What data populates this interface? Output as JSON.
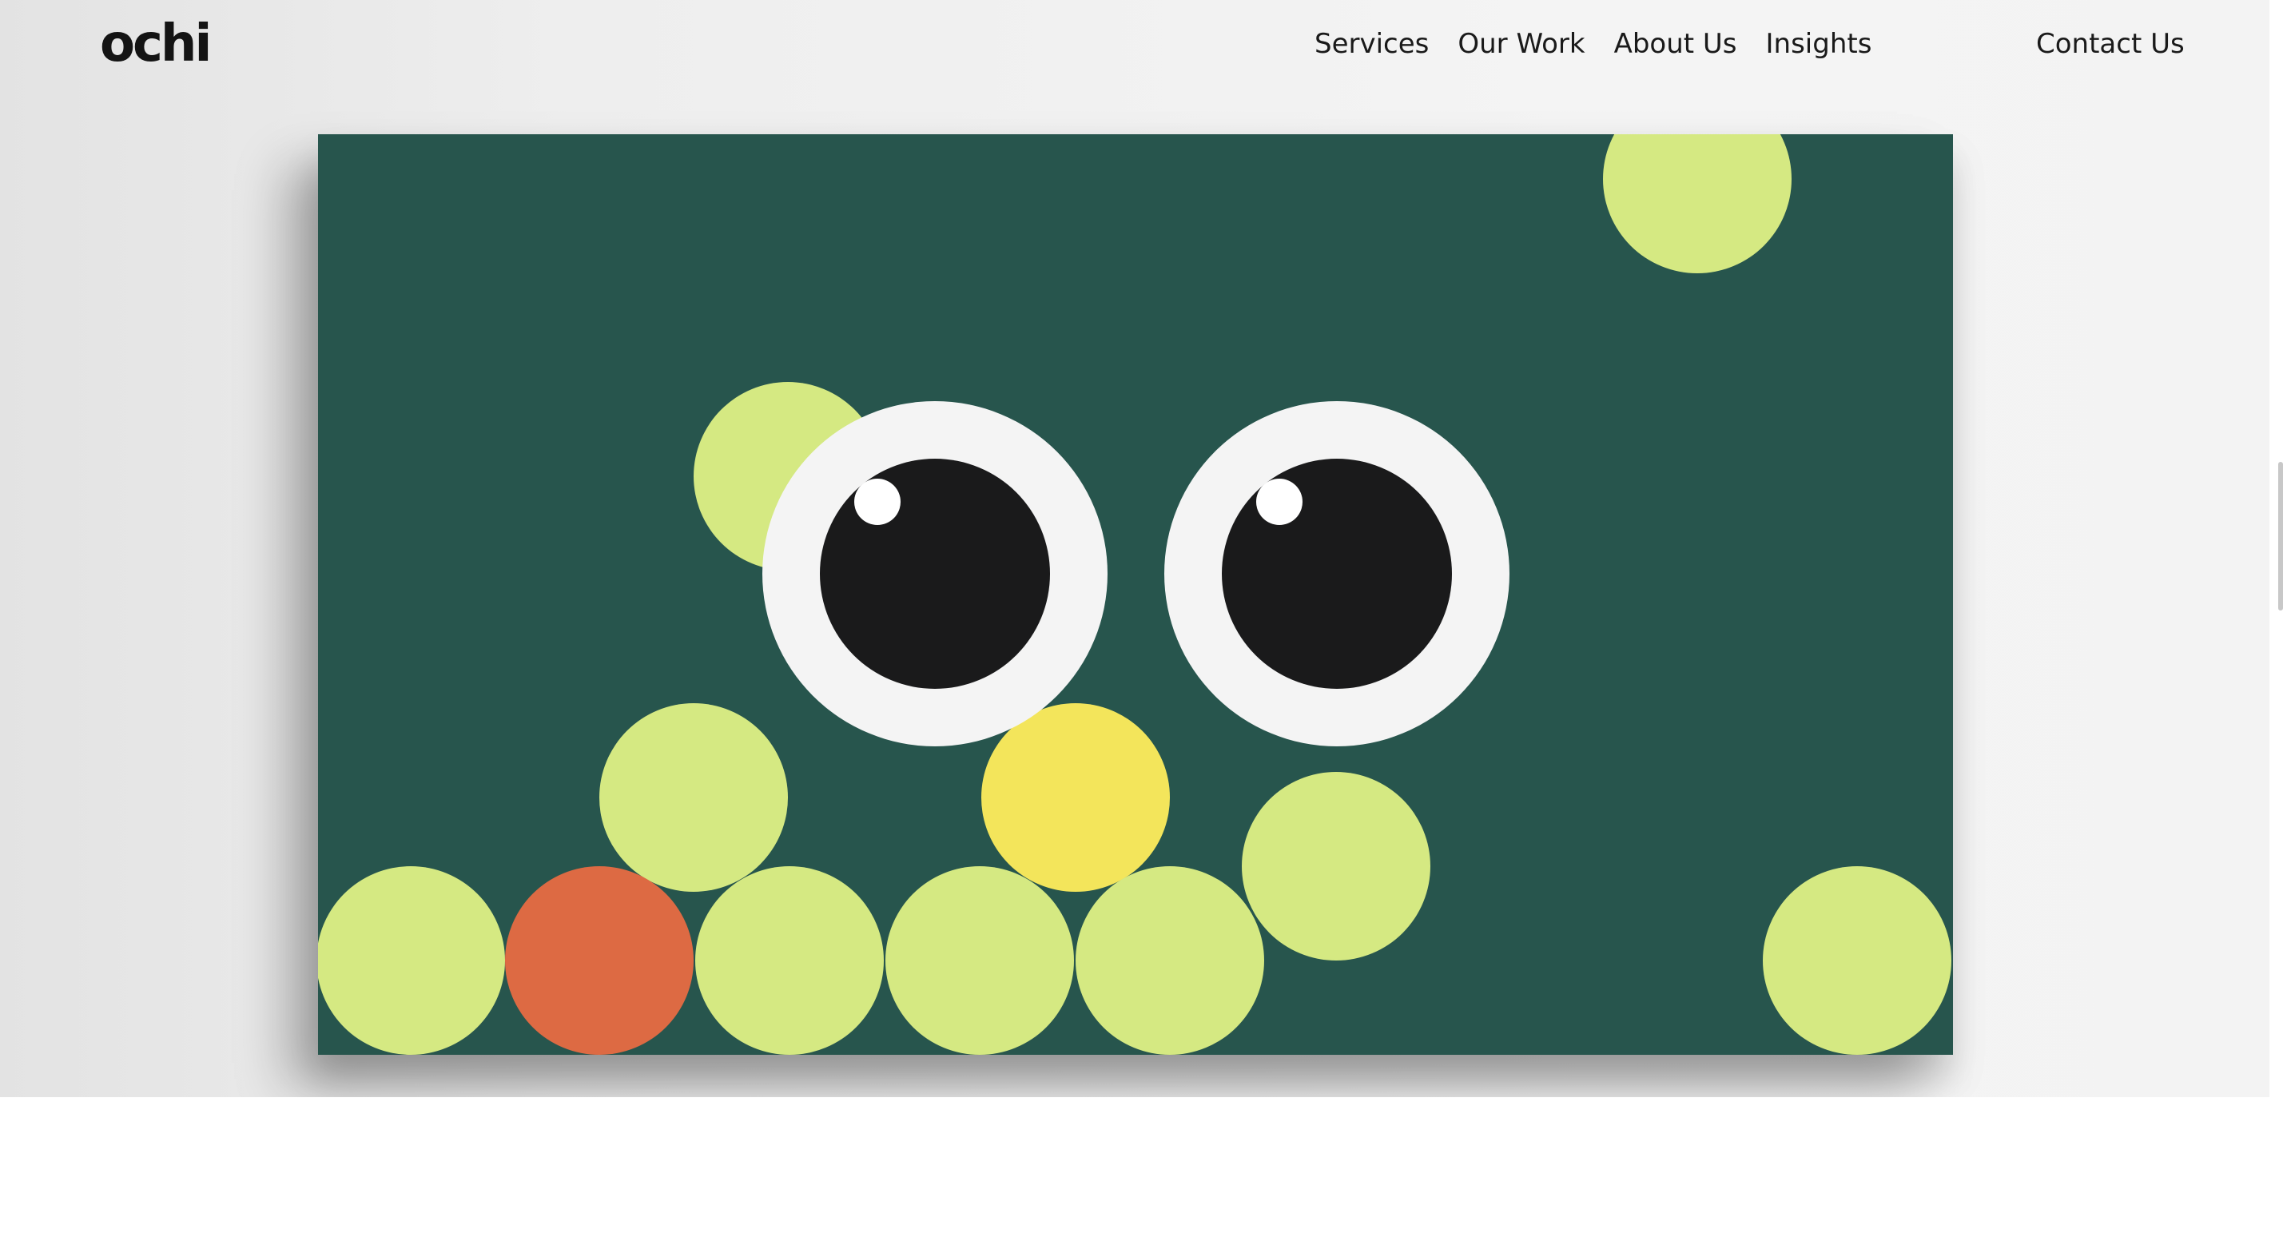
{
  "header": {
    "logo": "ochi",
    "nav": [
      "Services",
      "Our Work",
      "About Us",
      "Insights"
    ],
    "contact": "Contact Us"
  },
  "hero": {
    "background_color": "#27554d",
    "ball_colors": {
      "lime": "#d5e982",
      "yellow": "#f3e55b",
      "orange": "#dd6a43"
    },
    "eye_colors": {
      "sclera": "#f4f4f4",
      "pupil": "#1a1a1b",
      "highlight": "#ffffff"
    }
  }
}
